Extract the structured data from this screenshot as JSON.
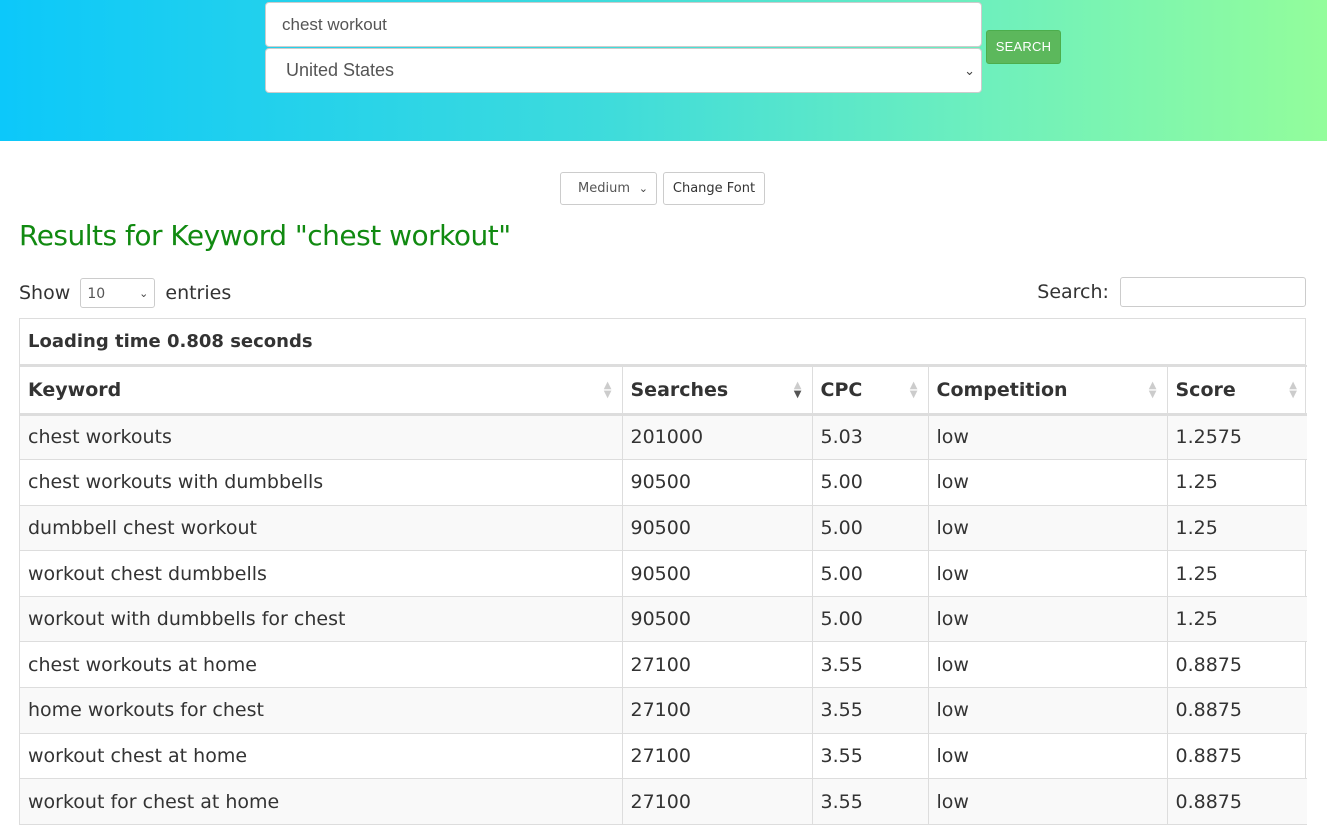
{
  "header": {
    "keyword_input_value": "chest workout",
    "country_selected": "United States",
    "search_button_label": "SEARCH",
    "gradient_start": "#0cc8fa",
    "gradient_end": "#93fd9b"
  },
  "font_controls": {
    "size_selected": "Medium",
    "change_font_label": "Change Font"
  },
  "results": {
    "title": "Results for Keyword \"chest workout\"",
    "show_label": "Show",
    "entries_selected": "10",
    "entries_label": "entries",
    "search_label": "Search:",
    "search_value": "",
    "loading_text": "Loading time 0.808 seconds",
    "columns": [
      {
        "label": "Keyword",
        "sorted": false
      },
      {
        "label": "Searches",
        "sorted": "desc"
      },
      {
        "label": "CPC",
        "sorted": false
      },
      {
        "label": "Competition",
        "sorted": false
      },
      {
        "label": "Score",
        "sorted": false
      }
    ],
    "rows": [
      [
        "chest workouts",
        "201000",
        "5.03",
        "low",
        "1.2575"
      ],
      [
        "chest workouts with dumbbells",
        "90500",
        "5.00",
        "low",
        "1.25"
      ],
      [
        "dumbbell chest workout",
        "90500",
        "5.00",
        "low",
        "1.25"
      ],
      [
        "workout chest dumbbells",
        "90500",
        "5.00",
        "low",
        "1.25"
      ],
      [
        "workout with dumbbells for chest",
        "90500",
        "5.00",
        "low",
        "1.25"
      ],
      [
        "chest workouts at home",
        "27100",
        "3.55",
        "low",
        "0.8875"
      ],
      [
        "home workouts for chest",
        "27100",
        "3.55",
        "low",
        "0.8875"
      ],
      [
        "workout chest at home",
        "27100",
        "3.55",
        "low",
        "0.8875"
      ],
      [
        "workout for chest at home",
        "27100",
        "3.55",
        "low",
        "0.8875"
      ]
    ],
    "title_color": "#118a11"
  },
  "icons": {
    "chevron_down": "⌄",
    "sort_up": "▲",
    "sort_down": "▼"
  }
}
